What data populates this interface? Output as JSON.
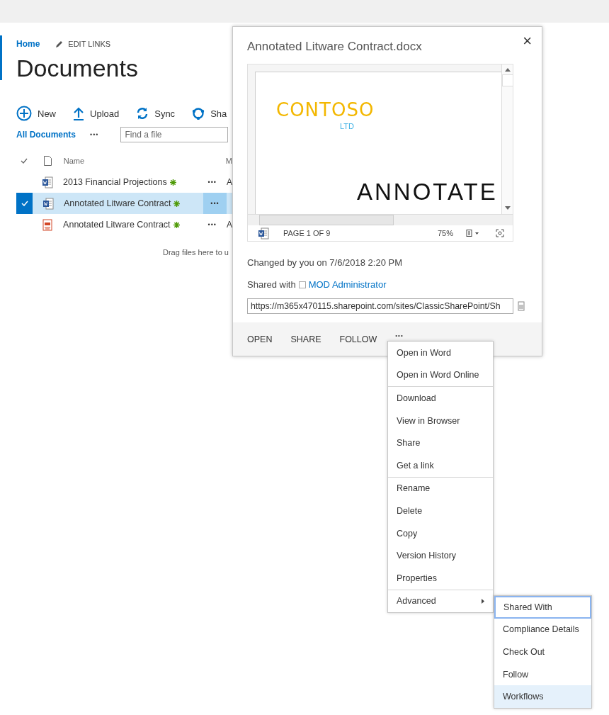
{
  "nav": {
    "home": "Home",
    "edit_links": "EDIT LINKS"
  },
  "page_title": "Documents",
  "toolbar": [
    {
      "kind": "new",
      "label": "New"
    },
    {
      "kind": "upload",
      "label": "Upload"
    },
    {
      "kind": "sync",
      "label": "Sync"
    },
    {
      "kind": "share",
      "label": "Sha"
    }
  ],
  "view": {
    "label": "All Documents",
    "more": "•••",
    "search": {
      "placeholder": "Find a file"
    }
  },
  "columns": [
    {
      "label": "Name"
    },
    {
      "label": "M"
    }
  ],
  "rows": [
    {
      "kind": "word",
      "name": "2013 Financial Projections",
      "more": "•••",
      "column_3": "A",
      "selected": false
    },
    {
      "kind": "word",
      "name": "Annotated Litware Contract",
      "more": "•••",
      "column_3": "",
      "selected": true
    },
    {
      "kind": "pdf",
      "name": "Annotated Litware Contract",
      "more": "•••",
      "column_3": "A",
      "selected": false
    }
  ],
  "drop_hint": "Drag files here to u",
  "callout": {
    "title": "Annotated Litware Contract.docx",
    "close": "×",
    "preview": {
      "logo": "CONTOSO",
      "logo_sub": "LTD",
      "heading": "ANNOTATE",
      "page": "PAGE 1 OF 9",
      "zoom": "75%"
    },
    "changed": "Changed by you on 7/6/2018 2:20 PM",
    "shared_label": "Shared with",
    "shared_user": "MOD Administrator",
    "url": "https://m365x470115.sharepoint.com/sites/ClassicSharePoint/Sh",
    "actions": [
      "OPEN",
      "SHARE",
      "FOLLOW",
      "•••"
    ]
  },
  "context_menu": [
    [
      {
        "kind": "command",
        "label": "Open in Word"
      },
      {
        "kind": "command",
        "label": "Open in Word Online"
      }
    ],
    [
      {
        "kind": "command",
        "label": "Download"
      },
      {
        "kind": "command",
        "label": "View in Browser"
      },
      {
        "kind": "command",
        "label": "Share"
      },
      {
        "kind": "command",
        "label": "Get a link"
      }
    ],
    [
      {
        "kind": "command",
        "label": "Rename"
      },
      {
        "kind": "command",
        "label": "Delete"
      },
      {
        "kind": "command",
        "label": "Copy"
      },
      {
        "kind": "command",
        "label": "Version History"
      },
      {
        "kind": "command",
        "label": "Properties"
      }
    ],
    [
      {
        "kind": "submenu",
        "label": "Advanced"
      }
    ]
  ],
  "submenu": [
    {
      "label": "Shared With",
      "focused": true,
      "hovered": false
    },
    {
      "label": "Compliance Details",
      "focused": false,
      "hovered": false
    },
    {
      "label": "Check Out",
      "focused": false,
      "hovered": false
    },
    {
      "label": "Follow",
      "focused": false,
      "hovered": false
    },
    {
      "label": "Workflows",
      "focused": false,
      "hovered": true
    }
  ]
}
